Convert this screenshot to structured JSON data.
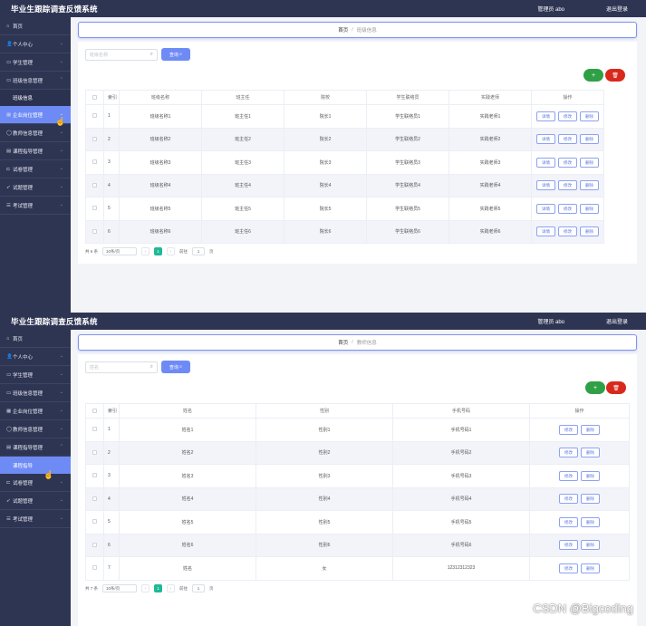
{
  "app_title": "毕业生跟踪调查反馈系统",
  "header": {
    "admin_label": "管理员 abo",
    "logout_label": "退出登录"
  },
  "menu": {
    "home": "首页",
    "personal": "个人中心",
    "students": "学生管理",
    "class_info": "班级信息管理",
    "class_info_sub": "班级信息",
    "company_jobs": "企业岗位管理",
    "teacher_info": "教师信息管理",
    "course_guidance": "课程指导管理",
    "course_guidance_sub": "课程指导",
    "question_bank": "试卷管理",
    "questions": "试题管理",
    "exam": "考试管理"
  },
  "screen1": {
    "breadcrumb": {
      "home": "首页",
      "current": "班级信息"
    },
    "search_placeholder": "班级名称",
    "search_button": "查询",
    "columns": [
      "索引",
      "班级名称",
      "班主任",
      "院校",
      "学生联络员",
      "实践老师",
      "操作"
    ],
    "rows": [
      [
        "1",
        "班级名称1",
        "班主任1",
        "院长1",
        "学生联络员1",
        "实践老师1"
      ],
      [
        "2",
        "班级名称2",
        "班主任2",
        "院长2",
        "学生联络员2",
        "实践老师2"
      ],
      [
        "3",
        "班级名称3",
        "班主任3",
        "院长3",
        "学生联络员3",
        "实践老师3"
      ],
      [
        "4",
        "班级名称4",
        "班主任4",
        "院长4",
        "学生联络员4",
        "实践老师4"
      ],
      [
        "5",
        "班级名称5",
        "班主任5",
        "院长5",
        "学生联络员5",
        "实践老师5"
      ],
      [
        "6",
        "班级名称6",
        "班主任6",
        "院长6",
        "学生联络员6",
        "实践老师6"
      ]
    ],
    "actions": [
      "详情",
      "修改",
      "删除"
    ],
    "pagination": {
      "total": "共 6 条",
      "page_size": "10条/页",
      "current_page": "1",
      "goto_label": "前往",
      "goto_value": "1",
      "page_suffix": "页"
    }
  },
  "screen2": {
    "breadcrumb": {
      "home": "首页",
      "current": "教师信息"
    },
    "search_placeholder": "姓名",
    "search_button": "查询",
    "columns": [
      "索引",
      "姓名",
      "性别",
      "手机号码",
      "操作"
    ],
    "rows": [
      [
        "1",
        "姓名1",
        "性别1",
        "手机号码1"
      ],
      [
        "2",
        "姓名2",
        "性别2",
        "手机号码2"
      ],
      [
        "3",
        "姓名3",
        "性别3",
        "手机号码3"
      ],
      [
        "4",
        "姓名4",
        "性别4",
        "手机号码4"
      ],
      [
        "5",
        "姓名5",
        "性别5",
        "手机号码5"
      ],
      [
        "6",
        "姓名6",
        "性别6",
        "手机号码6"
      ],
      [
        "7",
        "姓名",
        "女",
        "12312312323"
      ]
    ],
    "actions": [
      "修改",
      "删除"
    ],
    "pagination": {
      "total": "共 7 条",
      "page_size": "10条/页",
      "current_page": "1",
      "goto_label": "前往",
      "goto_value": "1",
      "page_suffix": "页"
    }
  },
  "icons": {
    "add": "plus-icon",
    "delete": "trash-icon",
    "search": "search-icon",
    "menu_chevron": "chevron-down-icon"
  },
  "colors": {
    "nav": "#2e3553",
    "accent": "#6e8bf5",
    "add": "#2fa046",
    "delete": "#d9291c",
    "page_current": "#1fb996"
  },
  "watermark": "CSDN @Bigcoding"
}
